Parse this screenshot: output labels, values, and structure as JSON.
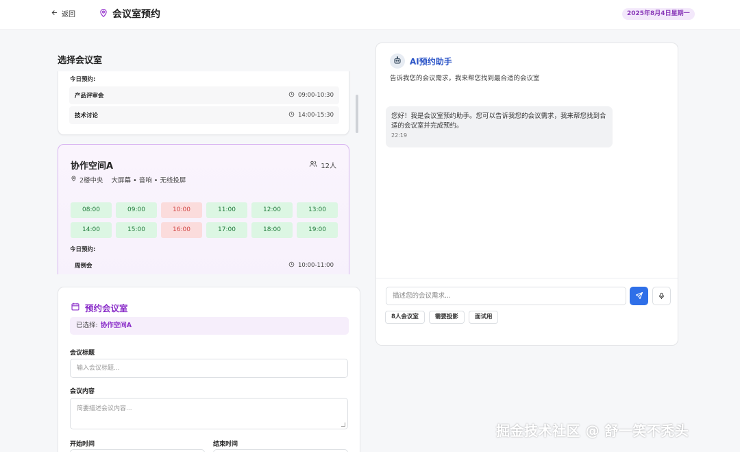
{
  "header": {
    "back_label": "返回",
    "title": "会议室预约",
    "date_badge": "2025年8月4日星期一"
  },
  "rooms_section": {
    "title": "选择会议室",
    "card1": {
      "today_label": "今日预约:",
      "meetings": [
        {
          "name": "产品评审会",
          "time": "09:00-10:30"
        },
        {
          "name": "技术讨论",
          "time": "14:00-15:30"
        }
      ]
    },
    "card2": {
      "name": "协作空间A",
      "capacity": "12人",
      "location": "2楼中央",
      "features": "大屏幕 • 音响 • 无线投屏",
      "slots": [
        {
          "time": "08:00",
          "status": "free"
        },
        {
          "time": "09:00",
          "status": "free"
        },
        {
          "time": "10:00",
          "status": "busy"
        },
        {
          "time": "11:00",
          "status": "free"
        },
        {
          "time": "12:00",
          "status": "free"
        },
        {
          "time": "13:00",
          "status": "free"
        },
        {
          "time": "14:00",
          "status": "free"
        },
        {
          "time": "15:00",
          "status": "free"
        },
        {
          "time": "16:00",
          "status": "busy"
        },
        {
          "time": "17:00",
          "status": "free"
        },
        {
          "time": "18:00",
          "status": "free"
        },
        {
          "time": "19:00",
          "status": "free"
        }
      ],
      "today_label": "今日预约:",
      "meetings": [
        {
          "name": "周例会",
          "time": "10:00-11:00"
        }
      ]
    }
  },
  "booking_form": {
    "title": "预约会议室",
    "selected_prefix": "已选择:",
    "selected_room": "协作空间A",
    "subject_label": "会议标题",
    "subject_placeholder": "输入会议标题...",
    "content_label": "会议内容",
    "content_placeholder": "简要描述会议内容...",
    "start_label": "开始时间",
    "end_label": "结束时间"
  },
  "assistant": {
    "title": "AI预约助手",
    "subtitle": "告诉我您的会议需求，我来帮您找到最合适的会议室",
    "messages": [
      {
        "text": "您好！我是会议室预约助手。您可以告诉我您的会议需求，我来帮您找到合适的会议室并完成预约。",
        "time": "22:19"
      }
    ],
    "input_placeholder": "描述您的会议需求...",
    "chips": [
      "8人会议室",
      "需要投影",
      "面试用"
    ]
  },
  "watermark": "掘金技术社区 @ 舒一笑不秃头",
  "colors": {
    "accent_purple": "#8b2fc9",
    "assistant_blue": "#2b54c7",
    "send_button": "#2f6fe8",
    "slot_free_bg": "#dcf6e3",
    "slot_busy_bg": "#fbdcdc"
  },
  "icons": [
    "arrow-left-icon",
    "map-pin-icon",
    "clock-icon",
    "users-icon",
    "calendar-icon",
    "robot-icon",
    "send-icon",
    "mic-icon"
  ]
}
